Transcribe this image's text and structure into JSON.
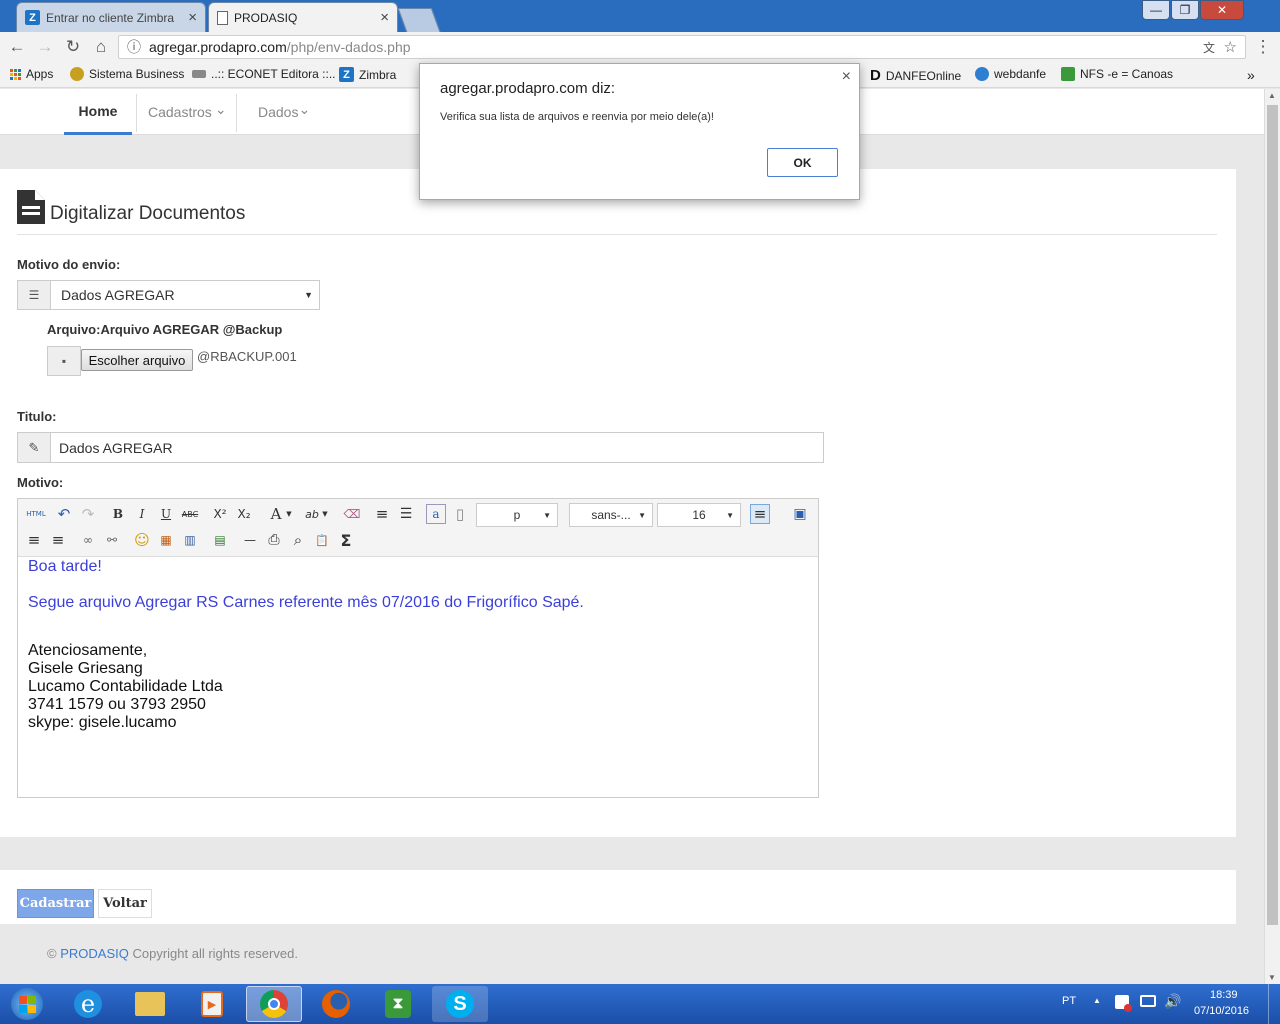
{
  "browser": {
    "tabs": [
      {
        "title": "Entrar no cliente Zimbra",
        "close": "×"
      },
      {
        "title": "PRODASIQ",
        "close": "×"
      }
    ],
    "url_domain": "agregar.prodapro.com",
    "url_path": "/php/env-dados.php",
    "window_buttons": {
      "minimize": "—",
      "restore": "❐",
      "close": "✕"
    },
    "nav": {
      "back": "←",
      "forward": "→",
      "reload": "↻",
      "home": "⌂",
      "info": "ⓘ",
      "translate": "文",
      "star": "☆",
      "menu": "⋮"
    },
    "bookmarks": [
      "Apps",
      "Sistema Business",
      "..:: ECONET Editora ::..",
      "Zimbra",
      "DANFEOnline",
      "webdanfe",
      "NFS -e = Canoas"
    ],
    "bookmarks_more": "»",
    "bookmark_colors": [
      "#e4542e",
      "#c8a020",
      "#888888",
      "#1d74c6",
      "#111111",
      "#2f7fd0",
      "#3a9a3a"
    ]
  },
  "nav": {
    "home": "Home",
    "cadastros": "Cadastros",
    "dados": "Dados",
    "caret": "⌄"
  },
  "form": {
    "title": "Digitalizar Documentos",
    "motivo_envio_label": "Motivo do envio:",
    "motivo_envio_value": "Dados AGREGAR",
    "arquivo_label": "Arquivo:Arquivo AGREGAR @Backup",
    "file_button": "Escolher arquivo",
    "file_name": "@RBACKUP.001",
    "titulo_label": "Titulo:",
    "titulo_value": "Dados AGREGAR",
    "motivo_label": "Motivo:"
  },
  "editor": {
    "toolbar_selects": {
      "block": "p",
      "font": "sans-...",
      "size": "16"
    },
    "toolbar_glyphs": {
      "html": "HTML",
      "undo": "↶",
      "redo": "↷",
      "bold": "B",
      "italic": "I",
      "underline": "U",
      "strike": "ABC",
      "superscript": "X²",
      "subscript": "X₂",
      "font_color": "A",
      "highlight": "ab",
      "eraser": "⌫",
      "ordered_list": "≡",
      "unordered_list": "☰",
      "spellcheck": "a",
      "blank_page": "▯",
      "align_left": "≡",
      "preview": "▣",
      "justify_center": "≡",
      "justify_right": "≡",
      "link": "∞",
      "unlink": "⚯",
      "emoji": "☺",
      "image": "▦",
      "video": "▥",
      "table": "▤",
      "hr": "—",
      "print": "⎙",
      "search": "⌕",
      "paste": "📋",
      "sigma": "Σ"
    },
    "lines_blue": [
      "Boa tarde!",
      "Segue arquivo Agregar RS Carnes referente mês 07/2016 do Frigorífico Sapé."
    ],
    "lines_black": [
      "Atenciosamente,",
      "Gisele Griesang",
      "Lucamo Contabilidade Ltda",
      "3741 1579 ou 3793 2950",
      "skype: gisele.lucamo"
    ],
    "blue_color": "#3b3fd9"
  },
  "buttons": {
    "cadastrar": "Cadastrar",
    "voltar": "Voltar"
  },
  "footer": {
    "copyright_symbol": "©",
    "brand": "PRODASIQ",
    "text": "Copyright all rights reserved."
  },
  "dialog": {
    "title": "agregar.prodapro.com diz:",
    "message": "Verifica sua lista de arquivos e reenvia por meio dele(a)!",
    "ok": "OK",
    "close": "×"
  },
  "taskbar": {
    "lang": "PT",
    "time": "18:39",
    "date": "07/10/2016",
    "apps": [
      "start-button",
      "internet-explorer",
      "file-explorer",
      "media-player",
      "chrome",
      "firefox",
      "hourglass-app",
      "skype"
    ]
  }
}
